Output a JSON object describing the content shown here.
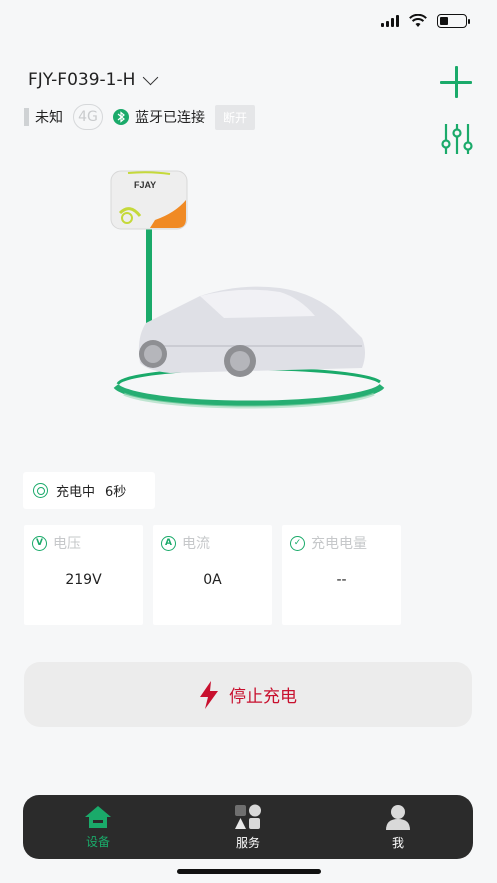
{
  "device": {
    "name": "FJY-F039-1-H"
  },
  "connection": {
    "network_label": "未知",
    "network_badge": "4G",
    "bluetooth_label": "蓝牙已连接",
    "disconnect_label": "断开"
  },
  "charger": {
    "brand": "FJAY"
  },
  "charging": {
    "status_label": "充电中",
    "duration": "6秒"
  },
  "metrics": [
    {
      "label": "电压",
      "value": "219V"
    },
    {
      "label": "电流",
      "value": "0A"
    },
    {
      "label": "充电电量",
      "value": "--"
    }
  ],
  "actions": {
    "stop_label": "停止充电"
  },
  "tabbar": {
    "tabs": [
      {
        "label": "设备",
        "active": true
      },
      {
        "label": "服务",
        "active": false
      },
      {
        "label": "我",
        "active": false
      }
    ]
  },
  "colors": {
    "accent": "#1aaa6a",
    "danger": "#c8102e",
    "tabbar_bg": "#2b2b2b"
  }
}
